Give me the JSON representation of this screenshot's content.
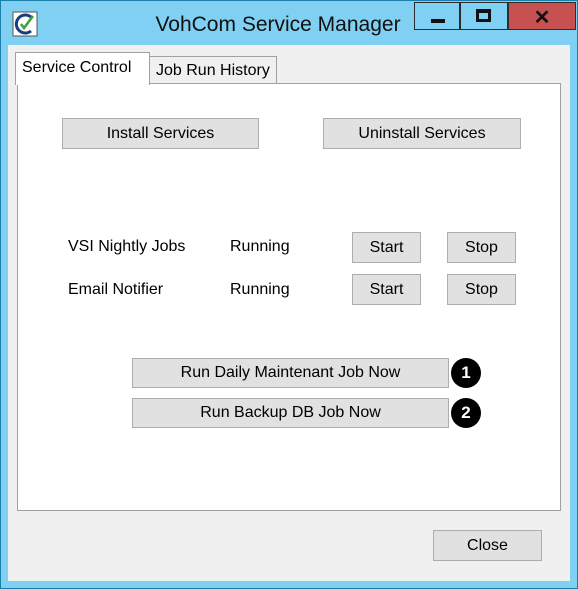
{
  "window": {
    "title": "VohCom Service Manager",
    "controls": {
      "minimize": "minimize-icon",
      "maximize": "maximize-icon",
      "close": "✕"
    }
  },
  "tabs": [
    {
      "label": "Service Control",
      "active": true
    },
    {
      "label": "Job Run History",
      "active": false
    }
  ],
  "service_control": {
    "install_label": "Install Services",
    "uninstall_label": "Uninstall Services",
    "services": [
      {
        "name": "VSI Nightly Jobs",
        "status": "Running",
        "start_label": "Start",
        "stop_label": "Stop"
      },
      {
        "name": "Email Notifier",
        "status": "Running",
        "start_label": "Start",
        "stop_label": "Stop"
      }
    ],
    "jobs": [
      {
        "label": "Run Daily Maintenant Job Now",
        "badge": "1"
      },
      {
        "label": "Run Backup DB Job Now",
        "badge": "2"
      }
    ]
  },
  "footer": {
    "close_label": "Close"
  },
  "colors": {
    "titlebar": "#7fd0f2",
    "close_button": "#c75050",
    "button_face": "#e1e1e1"
  }
}
